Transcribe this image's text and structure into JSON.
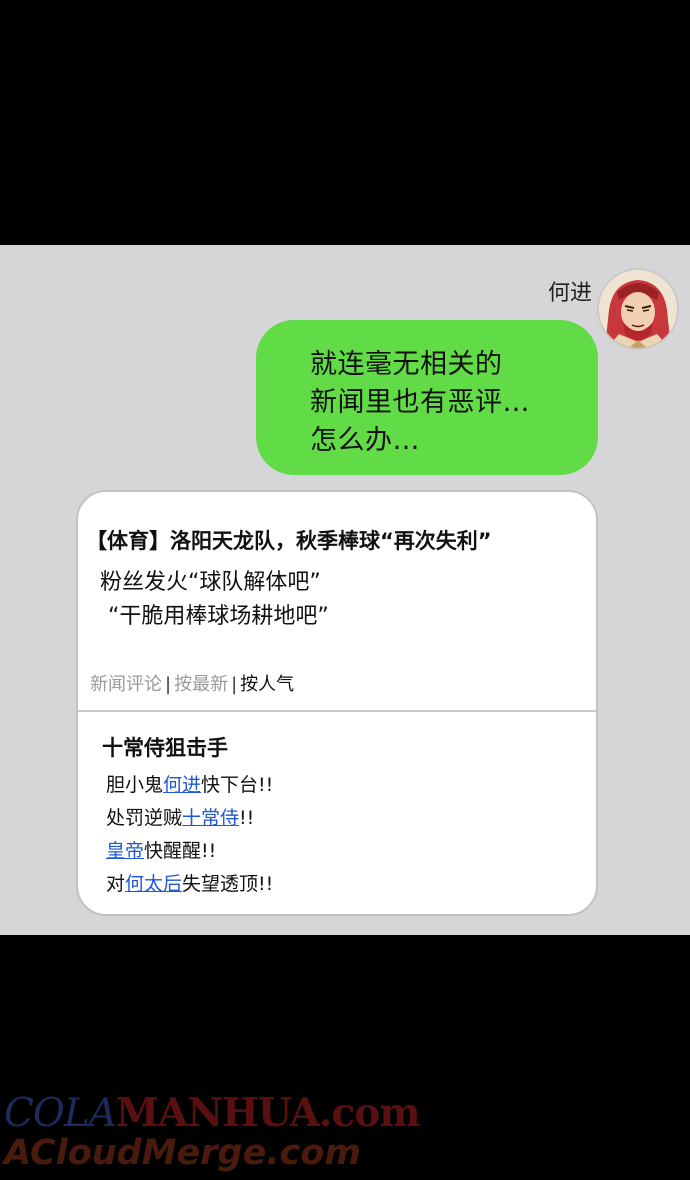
{
  "message": {
    "sender": "何进",
    "lines": [
      "就连毫无相关的",
      "新闻里也有恶评…",
      "怎么办…"
    ]
  },
  "news_card": {
    "headline": "【体育】洛阳天龙队，秋季棒球“再次失利”",
    "subline1": "粉丝发火“球队解体吧”",
    "subline2": "“干脆用棒球场耕地吧”",
    "sort": {
      "label": "新闻评论",
      "sep": "|",
      "newest": "按最新",
      "popular": "按人气"
    },
    "comment": {
      "author": "十常侍狙击手",
      "line1": {
        "pre": "胆小鬼",
        "link": "何进",
        "post": "快下台!!"
      },
      "line2": {
        "pre": "处罚逆贼",
        "link": "十常侍",
        "post": "!!"
      },
      "line3": {
        "link": "皇帝",
        "post": "快醒醒!!"
      },
      "line4": {
        "pre": "对",
        "link": "何太后",
        "post": "失望透顶!!"
      }
    }
  },
  "watermark": {
    "part1": "COLA",
    "part2": "MANHUA.com",
    "line2": "ACloudMerge.com"
  },
  "colors": {
    "bubble": "#61dc47",
    "panel": "#d6d6d8",
    "link": "#1f57d8"
  }
}
